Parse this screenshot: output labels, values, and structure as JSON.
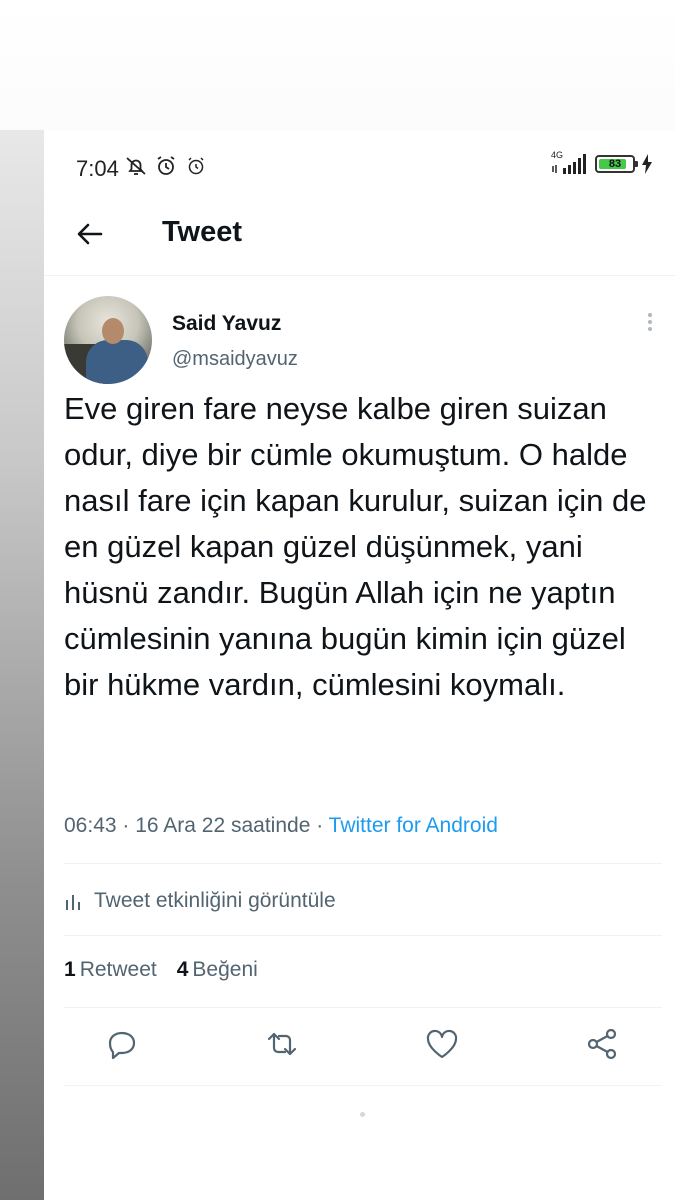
{
  "status_bar": {
    "time": "7:04",
    "network": "4G",
    "battery": "83",
    "battery_level": 0.83,
    "icons": [
      "bell-off-icon",
      "alarm-icon",
      "alarm-outline-icon",
      "signal-icon",
      "battery-icon",
      "charging-bolt-icon"
    ]
  },
  "header": {
    "title": "Tweet",
    "back_icon": "arrow-left-icon"
  },
  "tweet": {
    "author_name": "Said Yavuz",
    "author_handle": "@msaidyavuz",
    "text": "Eve giren fare neyse kalbe giren suizan odur, diye bir cümle okumuştum. O halde nasıl fare için kapan kurulur, suizan için de en güzel kapan güzel düşünmek, yani hüsnü zandır. Bugün Allah için ne yaptın cümlesinin yanına bugün kimin için güzel bir hükme vardın, cümlesini koymalı.",
    "time": "06:43",
    "date": "16 Ara 22 saatinde",
    "source": "Twitter for Android",
    "separator": " · "
  },
  "activity": {
    "label": "Tweet etkinliğini görüntüle",
    "icon": "analytics-bars-icon"
  },
  "stats": {
    "retweets_count": "1",
    "retweets_label": "Retweet",
    "likes_count": "4",
    "likes_label": "Beğeni"
  },
  "actions": [
    "reply-icon",
    "retweet-icon",
    "like-icon",
    "share-icon"
  ],
  "colors": {
    "text_primary": "#0f1419",
    "text_secondary": "#536471",
    "link": "#1d9bf0",
    "divider": "#eff3f4",
    "battery_fill": "#46c84a"
  }
}
